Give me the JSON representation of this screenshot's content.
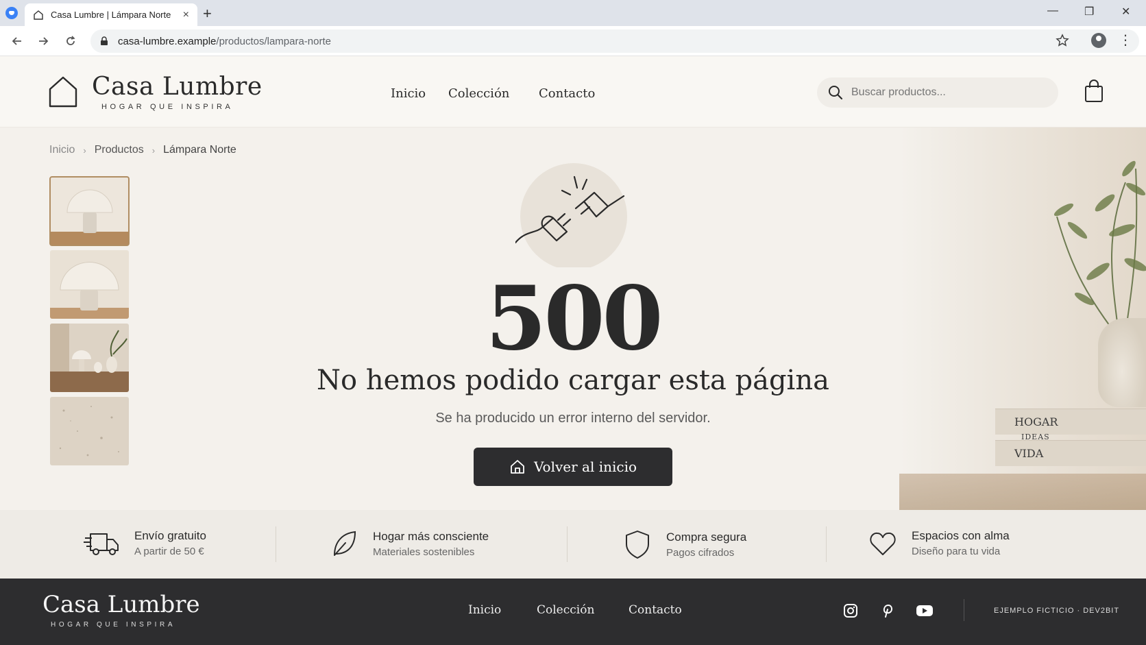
{
  "browser": {
    "tab_title": "Casa Lumbre | Lámpara Norte",
    "new_tab": "+",
    "url_domain": "casa-lumbre.example",
    "url_path": "/productos/lampara-norte",
    "win_min": "—",
    "win_max": "❐",
    "win_close": "✕"
  },
  "header": {
    "brand": "Casa Lumbre",
    "tagline": "HOGAR QUE INSPIRA",
    "nav": [
      "Inicio",
      "Colección",
      "Contacto"
    ],
    "search_placeholder": "Buscar productos..."
  },
  "breadcrumb": [
    "Inicio",
    "Productos",
    "Lámpara Norte"
  ],
  "error": {
    "code": "500",
    "title": "No hemos podido cargar esta página",
    "subtitle": "Se ha producido un error interno del servidor.",
    "button": "Volver al inicio"
  },
  "decor": {
    "book1": "HOGAR",
    "book2": "IDEAS",
    "book3": "VIDA"
  },
  "features": [
    {
      "title": "Envío gratuito",
      "sub": "A partir de 50 €",
      "icon": "truck-icon"
    },
    {
      "title": "Hogar más consciente",
      "sub": "Materiales sostenibles",
      "icon": "leaf-icon"
    },
    {
      "title": "Compra segura",
      "sub": "Pagos cifrados",
      "icon": "shield-icon"
    },
    {
      "title": "Espacios con alma",
      "sub": "Diseño para tu vida",
      "icon": "heart-icon"
    }
  ],
  "footer": {
    "brand": "Casa Lumbre",
    "tagline": "HOGAR QUE INSPIRA",
    "nav": [
      "Inicio",
      "Colección",
      "Contacto"
    ],
    "credit": "EJEMPLO FICTICIO · DEV2BIT"
  },
  "colors": {
    "accent_dark": "#2d2d2f",
    "background": "#f4f1ec",
    "thumb_border": "#b08d62"
  }
}
